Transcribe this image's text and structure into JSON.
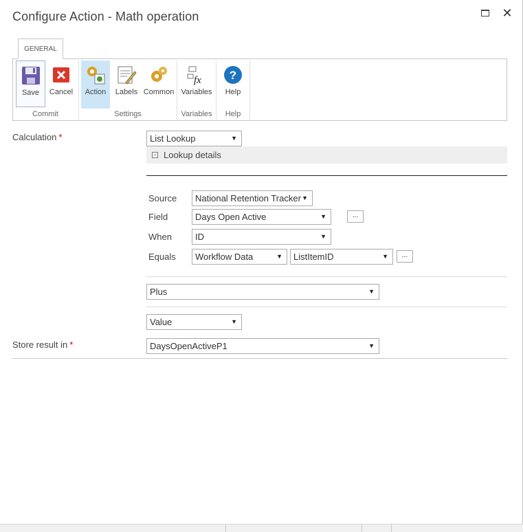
{
  "dialog": {
    "title": "Configure Action - Math operation"
  },
  "ribbon": {
    "tab": "GENERAL",
    "buttons": {
      "save": "Save",
      "cancel": "Cancel",
      "action": "Action",
      "labels": "Labels",
      "common": "Common",
      "variables": "Variables",
      "help": "Help"
    },
    "groups": {
      "commit": "Commit",
      "settings": "Settings",
      "variables": "Variables",
      "help": "Help"
    }
  },
  "form": {
    "calculation_label": "Calculation",
    "required_mark": "*",
    "calculation_value": "List Lookup",
    "lookup_details": "Lookup details",
    "source_label": "Source",
    "source_value": "National Retention Tracker",
    "field_label": "Field",
    "field_value": "Days Open Active",
    "when_label": "When",
    "when_value": "ID",
    "equals_label": "Equals",
    "equals_value1": "Workflow Data",
    "equals_value2": "ListItemID",
    "ellipsis": "...",
    "operator_value": "Plus",
    "value_type": "Value",
    "store_label": "Store result in",
    "store_value": "DaysOpenActiveP1"
  },
  "colors": {
    "selected_bg": "#cde6f7",
    "required": "#cc0000",
    "help_blue": "#1e73be",
    "cancel_red": "#d9382a"
  }
}
